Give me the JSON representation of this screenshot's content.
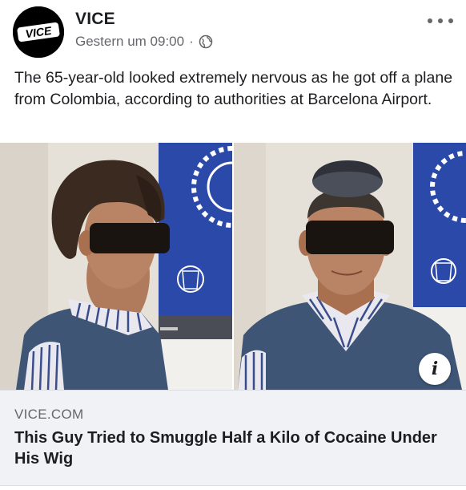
{
  "post": {
    "page_name": "VICE",
    "avatar_text": "VICE",
    "timestamp": "Gestern um 09:00",
    "separator": "·",
    "audience_icon": "globe-icon",
    "more_icon": "more-options-icon",
    "text": "The 65-year-old looked extremely nervous as he got off a plane from Colombia, according to authorities at Barcelona Airport."
  },
  "media": {
    "photos": [
      {
        "description_icon": "photo-left"
      },
      {
        "description_icon": "photo-right"
      }
    ],
    "info_label": "i",
    "info_icon": "info-icon"
  },
  "link_preview": {
    "domain": "VICE.COM",
    "title": "This Guy Tried to Smuggle Half a Kilo of Cocaine Under His Wig"
  },
  "colors": {
    "text_primary": "#1c1e21",
    "text_secondary": "#65676b",
    "preview_bg": "#f0f2f5",
    "police_blue": "#2a49a8"
  }
}
